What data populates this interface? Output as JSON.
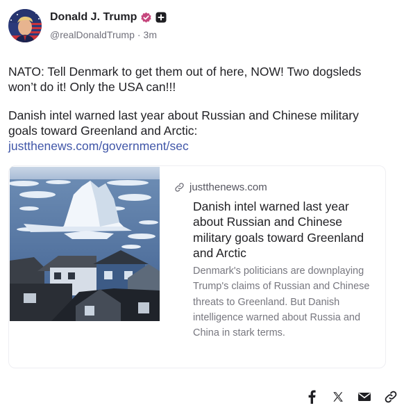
{
  "author": {
    "display_name": "Donald J. Trump",
    "handle": "@realDonaldTrump",
    "separator": "·",
    "timestamp": "3m",
    "verified_color": "#c6477d"
  },
  "post": {
    "paragraph_1": "NATO: Tell Denmark to get them out of here, NOW! Two dogsleds won’t do it! Only the USA can!!!",
    "paragraph_2": "Danish intel warned last year about Russian and Chinese military goals toward Greenland and Arctic:",
    "link_text": "justthenews.com/government/sec"
  },
  "link_card": {
    "domain": "justthenews.com",
    "title": "Danish intel warned last year about Russian and Chinese military goals toward Greenland and Arctic",
    "description": "Denmark's politicians are downplaying Trump's claims of Russian and Chinese threats to Greenland. But Danish intelligence warned about Russia and China in stark terms."
  },
  "share": {
    "icons": [
      "facebook-icon",
      "x-icon",
      "email-icon",
      "link-icon"
    ]
  },
  "colors": {
    "link": "#4056a8",
    "text": "#1f1f23",
    "muted": "#6f6f7a"
  }
}
